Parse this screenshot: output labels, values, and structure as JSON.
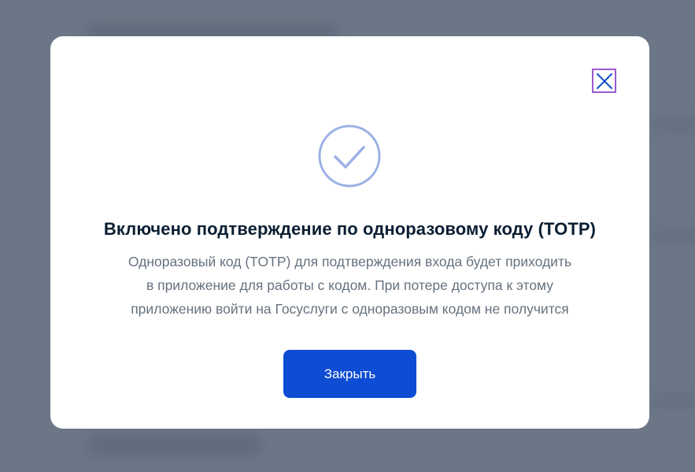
{
  "modal": {
    "title": "Включено подтверждение по одноразовому коду (TOTP)",
    "description_lines": [
      "Одноразовый код (TOTP) для подтверждения входа будет приходить",
      "в приложение для работы с кодом. При потере доступа к этому",
      "приложению войти на Госуслуги с одноразовым кодом не получится"
    ],
    "close_button_label": "Закрыть",
    "close_icon": "close-icon",
    "status_icon": "check-circle-icon"
  },
  "colors": {
    "overlay": "#6b7786",
    "modal_background": "#ffffff",
    "title": "#0b1f33",
    "text": "#66727f",
    "primary_button": "#0d4cd3",
    "success_icon": "#9bb1e5",
    "close_icon": "#0d4cd3",
    "focus_outline": "#9b5ad0"
  }
}
